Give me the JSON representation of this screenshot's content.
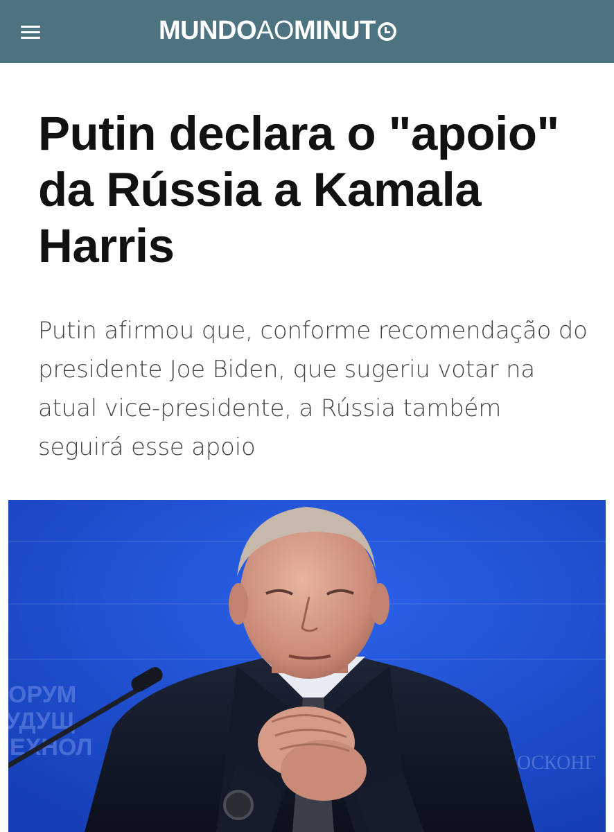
{
  "header": {
    "menu_icon": "hamburger-menu-icon",
    "logo": {
      "part1": "MUNDO",
      "part2": "AO",
      "part3": "MINUT",
      "clock_icon": "clock-icon"
    },
    "background_color": "#4d7280"
  },
  "article": {
    "headline": "Putin declara o \"apoio\" da Rússia a Kamala Harris",
    "subtitle": "Putin afirmou que, conforme recomendação do presidente Joe Biden, que sugeriu votar na atual vice-presidente, a Rússia também seguirá esse apoio",
    "photo": {
      "backdrop_text_left": "ОРУМ\nУДУЩ\nЕХНОЛ",
      "backdrop_text_right": "РОСКОНГ"
    }
  }
}
